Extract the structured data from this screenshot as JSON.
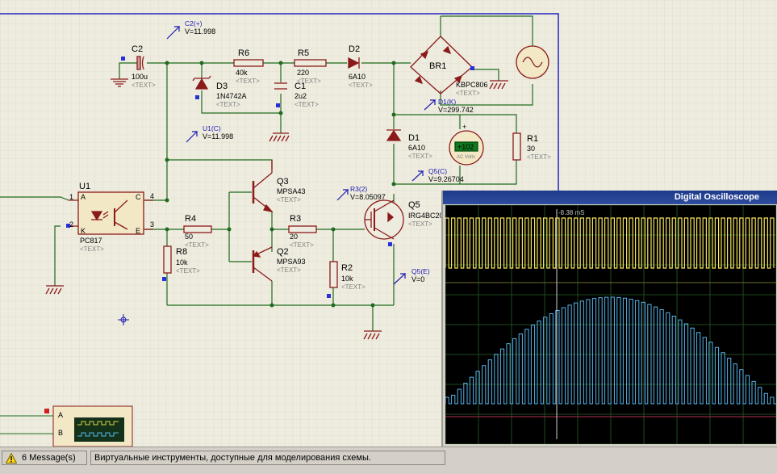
{
  "schematic": {
    "probes": {
      "c2": {
        "name": "C2(+)",
        "value": "V=11.998"
      },
      "u1c": {
        "name": "U1(C)",
        "value": "V=11.998"
      },
      "d1k": {
        "name": "D1(K)",
        "value": "V=299.742"
      },
      "q5c": {
        "name": "Q5(C)",
        "value": "V=9.26704"
      },
      "r32": {
        "name": "R3(2)",
        "value": "V=8.05097"
      },
      "q5e": {
        "name": "Q5(E)",
        "value": "V=0"
      }
    },
    "components": {
      "c2": {
        "ref": "C2",
        "value": "100u"
      },
      "r6": {
        "ref": "R6",
        "value": "40k"
      },
      "r5": {
        "ref": "R5",
        "value": "220"
      },
      "d2": {
        "ref": "D2",
        "value": "6A10"
      },
      "br1": {
        "ref": "BR1",
        "value": "KBPC806"
      },
      "d3": {
        "ref": "D3",
        "value": "1N4742A"
      },
      "c1": {
        "ref": "C1",
        "value": "2u2"
      },
      "d1": {
        "ref": "D1",
        "value": "6A10"
      },
      "r1": {
        "ref": "R1",
        "value": "30"
      },
      "u1": {
        "ref": "U1",
        "value": "PC817"
      },
      "q3": {
        "ref": "Q3",
        "value": "MPSA43"
      },
      "q2": {
        "ref": "Q2",
        "value": "MPSA93"
      },
      "q5": {
        "ref": "Q5",
        "value": "IRG4BC20"
      },
      "r4": {
        "ref": "R4",
        "value": "50"
      },
      "r3": {
        "ref": "R3",
        "value": "20"
      },
      "r8": {
        "ref": "R8",
        "value": "10k"
      },
      "r2": {
        "ref": "R2",
        "value": "10k"
      }
    },
    "text_placeholder": "<TEXT>",
    "voltmeter": {
      "reading": "+102",
      "unit": "AC Volts"
    },
    "u1_pins": {
      "p1": "1",
      "p2": "2",
      "p3": "3",
      "p4": "4",
      "a": "A",
      "k": "K",
      "c": "C",
      "e": "E"
    },
    "scope_instrument": {
      "ch_a": "A",
      "ch_b": "B"
    }
  },
  "oscilloscope": {
    "title": "Digital Oscilloscope",
    "cursor_time": "-8.38 mS"
  },
  "statusbar": {
    "messages": "6 Message(s)",
    "hint": "Виртуальные инструменты, доступные для моделирования схемы."
  },
  "colors": {
    "wire": "#1f6b1f",
    "component": "#8b1a1a",
    "probe": "#1b1bb0",
    "trace_a": "#f5e35a",
    "trace_b": "#58b4ea"
  }
}
